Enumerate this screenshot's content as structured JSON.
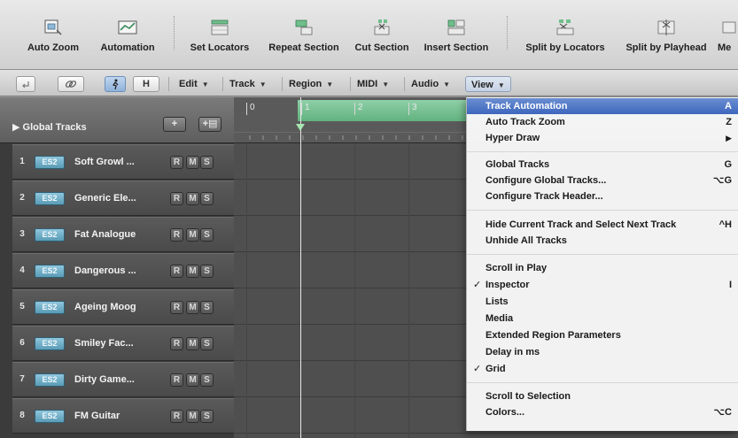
{
  "toolbar": {
    "buttons": [
      {
        "label": "Auto Zoom",
        "icon": "auto-zoom-icon"
      },
      {
        "label": "Automation",
        "icon": "automation-icon"
      },
      {
        "label": "Set Locators",
        "icon": "set-locators-icon"
      },
      {
        "label": "Repeat Section",
        "icon": "repeat-section-icon"
      },
      {
        "label": "Cut Section",
        "icon": "cut-section-icon"
      },
      {
        "label": "Insert Section",
        "icon": "insert-section-icon"
      },
      {
        "label": "Split by Locators",
        "icon": "split-by-locators-icon"
      },
      {
        "label": "Split by Playhead",
        "icon": "split-by-playhead-icon"
      },
      {
        "label": "Me",
        "icon": "merge-icon"
      }
    ]
  },
  "controls": {
    "h_label": "H",
    "menus": [
      {
        "label": "Edit",
        "arrow": "▼"
      },
      {
        "label": "Track",
        "arrow": "▼"
      },
      {
        "label": "Region",
        "arrow": "▼"
      },
      {
        "label": "MIDI",
        "arrow": "▼"
      },
      {
        "label": "Audio",
        "arrow": "▼"
      },
      {
        "label": "View",
        "arrow": "▼"
      }
    ]
  },
  "global_tracks": {
    "label": "▶ Global Tracks",
    "add_label": "+",
    "folder_label": "+▤"
  },
  "tracks": [
    {
      "num": "1",
      "inst": "ES2",
      "name": "Soft Growl ...",
      "r": "R",
      "m": "M",
      "s": "S"
    },
    {
      "num": "2",
      "inst": "ES2",
      "name": "Generic Ele...",
      "r": "R",
      "m": "M",
      "s": "S"
    },
    {
      "num": "3",
      "inst": "ES2",
      "name": "Fat Analogue",
      "r": "R",
      "m": "M",
      "s": "S"
    },
    {
      "num": "4",
      "inst": "ES2",
      "name": "Dangerous ...",
      "r": "R",
      "m": "M",
      "s": "S"
    },
    {
      "num": "5",
      "inst": "ES2",
      "name": "Ageing Moog",
      "r": "R",
      "m": "M",
      "s": "S"
    },
    {
      "num": "6",
      "inst": "ES2",
      "name": "Smiley Fac...",
      "r": "R",
      "m": "M",
      "s": "S"
    },
    {
      "num": "7",
      "inst": "ES2",
      "name": "Dirty Game...",
      "r": "R",
      "m": "M",
      "s": "S"
    },
    {
      "num": "8",
      "inst": "ES2",
      "name": "FM Guitar",
      "r": "R",
      "m": "M",
      "s": "S"
    }
  ],
  "ruler": {
    "bars": [
      "0",
      "1",
      "2",
      "3"
    ]
  },
  "view_menu": {
    "items": [
      {
        "label": "Track Automation",
        "shortcut": "A",
        "checked": "",
        "highlighted": true
      },
      {
        "label": "Auto Track Zoom",
        "shortcut": "Z",
        "checked": ""
      },
      {
        "label": "Hyper Draw",
        "shortcut": "▶",
        "checked": ""
      },
      {
        "label": "Global Tracks",
        "shortcut": "G",
        "checked": ""
      },
      {
        "label": "Configure Global Tracks...",
        "shortcut": "⌥G",
        "checked": ""
      },
      {
        "label": "Configure Track Header...",
        "shortcut": "",
        "checked": ""
      },
      {
        "label": "Hide Current Track and Select Next Track",
        "shortcut": "^H",
        "checked": ""
      },
      {
        "label": "Unhide All Tracks",
        "shortcut": "",
        "checked": ""
      },
      {
        "label": "Scroll in Play",
        "shortcut": "",
        "checked": ""
      },
      {
        "label": "Inspector",
        "shortcut": "I",
        "checked": "✓"
      },
      {
        "label": "Lists",
        "shortcut": "",
        "checked": ""
      },
      {
        "label": "Media",
        "shortcut": "",
        "checked": ""
      },
      {
        "label": "Extended Region Parameters",
        "shortcut": "",
        "checked": ""
      },
      {
        "label": "Delay in ms",
        "shortcut": "",
        "checked": ""
      },
      {
        "label": "Grid",
        "shortcut": "",
        "checked": "✓"
      },
      {
        "label": "Scroll to Selection",
        "shortcut": "",
        "checked": ""
      },
      {
        "label": "Colors...",
        "shortcut": "⌥C",
        "checked": ""
      }
    ]
  },
  "colors": {
    "cycle_region": "#6fbf8c",
    "instrument_badge": "#6fb0c8",
    "menu_highlight": "#4a72c4"
  }
}
